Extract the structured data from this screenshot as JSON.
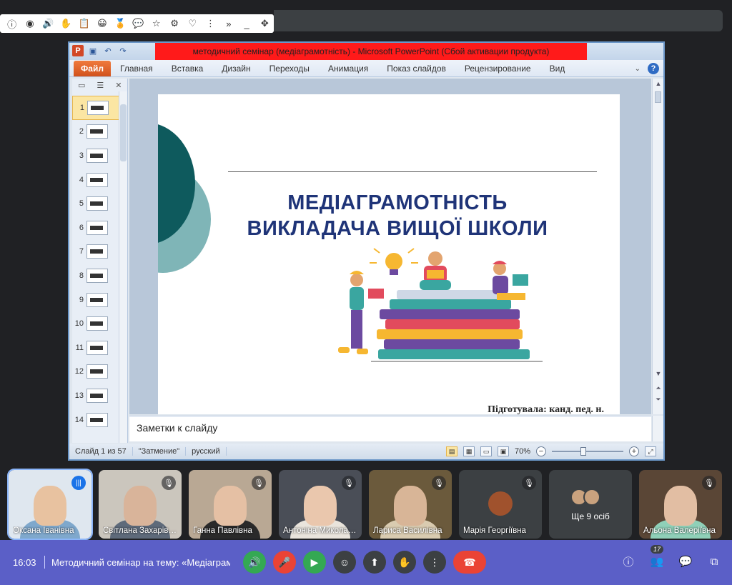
{
  "extensions": [
    "ⓘ",
    "◉",
    "🔊",
    "✋",
    "📋",
    "😀",
    "🏅",
    "💬",
    "☆",
    "⚙",
    "♡",
    "⋮",
    "»",
    "_",
    "✥"
  ],
  "ppt": {
    "title": "методичний семінар (медіаграмотність)  -  Microsoft PowerPoint (Сбой активации продукта)",
    "tabs": [
      "Файл",
      "Главная",
      "Вставка",
      "Дизайн",
      "Переходы",
      "Анимация",
      "Показ слайдов",
      "Рецензирование",
      "Вид"
    ],
    "thumbnails": [
      "1",
      "2",
      "3",
      "4",
      "5",
      "6",
      "7",
      "8",
      "9",
      "10",
      "11",
      "12",
      "13",
      "14"
    ],
    "slide": {
      "headline_1": "МЕДІАГРАМОТНІСТЬ",
      "headline_2": "ВИКЛАДАЧА ВИЩОЇ ШКОЛИ",
      "byline": "Підготувала: канд. пед. н."
    },
    "notes_placeholder": "Заметки к слайду",
    "status": {
      "slide_count": "Слайд 1 из 57",
      "theme": "\"Затмение\"",
      "language": "русский",
      "zoom": "70%"
    },
    "colors": {
      "title_highlight": "#ff1a1a",
      "headline": "#1f3478",
      "circle_dark": "#0e5a5d",
      "circle_light": "#7fb5b7"
    }
  },
  "participants": [
    {
      "name": "Оксана Іванівна",
      "state": "speaking",
      "skin": "#e8c2a0",
      "top": "#7fa8cc",
      "bg": "#dfe7ef"
    },
    {
      "name": "Світлана Захарівна",
      "state": "muted",
      "skin": "#d9b49a",
      "top": "#5e6a7a",
      "bg": "#cbc6bd"
    },
    {
      "name": "Ганна Павлівна",
      "state": "muted",
      "skin": "#e5c0a4",
      "top": "#2a2a2a",
      "bg": "#b9a894"
    },
    {
      "name": "Антоніна Миколаївна",
      "state": "muted",
      "skin": "#eac7ad",
      "top": "#e9e4dc",
      "bg": "#4a4e57"
    },
    {
      "name": "Лариса Василівна",
      "state": "muted",
      "skin": "#d8b597",
      "top": "#d9cbb0",
      "bg": "#6b5a3c"
    },
    {
      "name": "Марія Георгіївна",
      "state": "muted-avatar"
    },
    {
      "name": "Ще 9 осіб",
      "state": "more"
    },
    {
      "name": "Альона Валеріївна",
      "state": "muted",
      "skin": "#e2bea3",
      "top": "#8fd0b8",
      "bg": "#5a4636"
    }
  ],
  "meet": {
    "time": "16:03",
    "title": "Методичний семінар на тему: «Медіаграмотність викладача вищої школи»",
    "participant_count": "17",
    "controls": [
      {
        "id": "audio",
        "glyph": "🔊"
      },
      {
        "id": "mic",
        "glyph": "🎤"
      },
      {
        "id": "camera",
        "glyph": "▶"
      },
      {
        "id": "emoji",
        "glyph": "☺"
      },
      {
        "id": "present",
        "glyph": "⬆"
      },
      {
        "id": "raise-hand",
        "glyph": "✋"
      },
      {
        "id": "more",
        "glyph": "⋮"
      },
      {
        "id": "hangup",
        "glyph": "☎"
      }
    ],
    "right": [
      "ⓘ",
      "👥",
      "💬",
      "⧉"
    ]
  }
}
